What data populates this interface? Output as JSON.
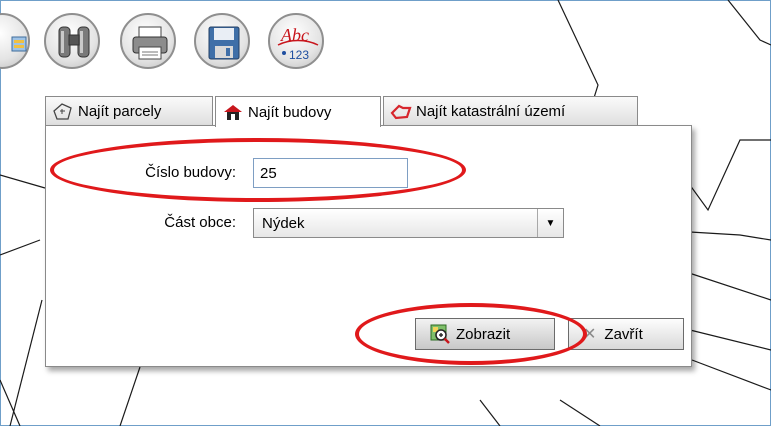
{
  "toolbar": {
    "buttons": [
      {
        "name": "layers-icon"
      },
      {
        "name": "binoculars-icon"
      },
      {
        "name": "print-icon"
      },
      {
        "name": "save-icon"
      },
      {
        "name": "abc-123-icon",
        "abc": "Abc",
        "num": "123"
      }
    ]
  },
  "tabs": [
    {
      "label": "Najít parcely",
      "icon": "parcel-icon",
      "active": false
    },
    {
      "label": "Najít budovy",
      "icon": "house-icon",
      "active": true
    },
    {
      "label": "Najít katastrální území",
      "icon": "territory-icon",
      "active": false
    }
  ],
  "form": {
    "building_number": {
      "label": "Číslo budovy:",
      "value": "25"
    },
    "municipality_part": {
      "label": "Část obce:",
      "selected": "Nýdek"
    }
  },
  "actions": {
    "show_label": "Zobrazit",
    "close_label": "Zavřít"
  },
  "colors": {
    "highlight": "#e0191b",
    "close_x": "#8a8a8a",
    "house_roof": "#c8161d",
    "territory": "#d7262d"
  }
}
